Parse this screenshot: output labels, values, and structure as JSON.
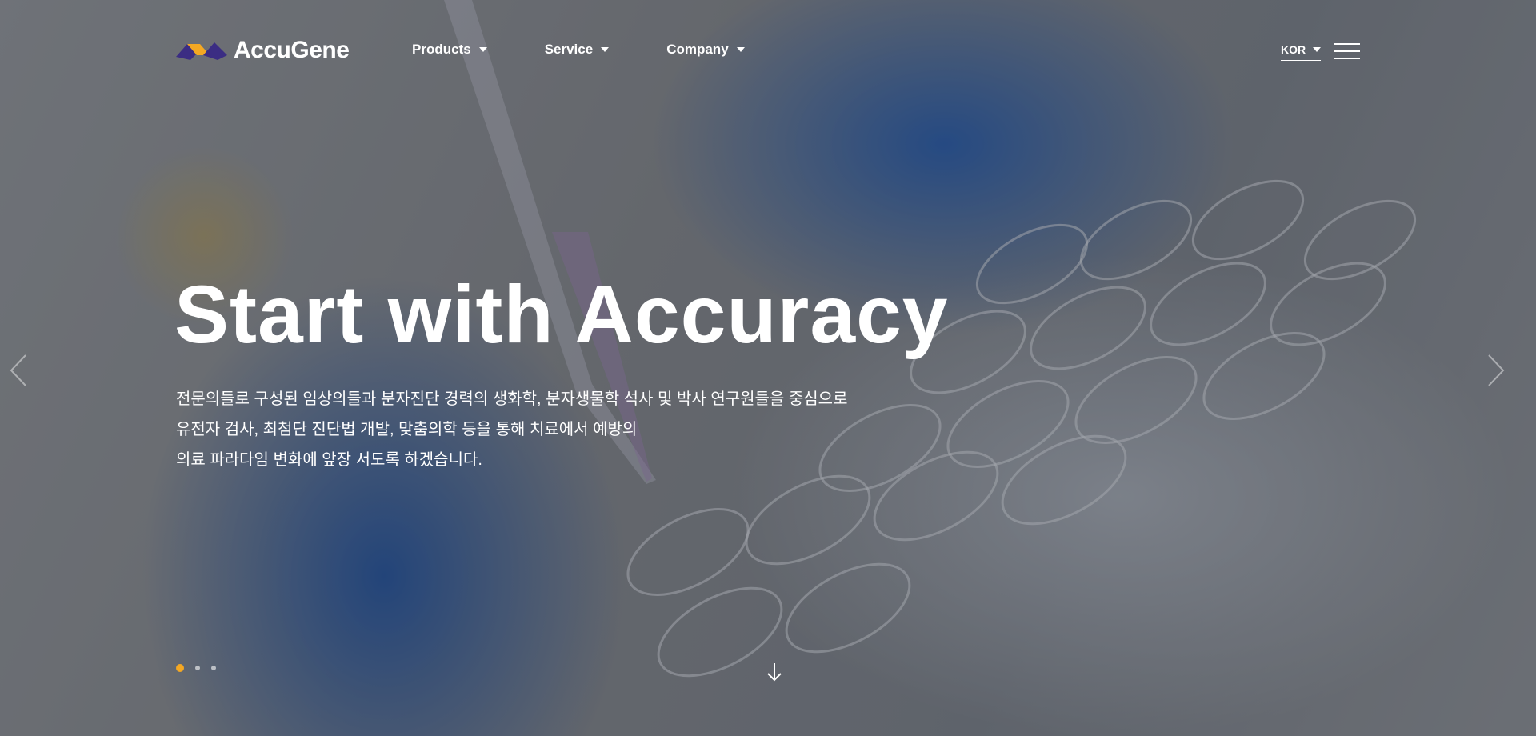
{
  "brand": {
    "name": "AccuGene",
    "accent": "#f4a823",
    "mark_dark": "#3b2d83"
  },
  "nav": {
    "items": [
      {
        "label": "Products"
      },
      {
        "label": "Service"
      },
      {
        "label": "Company"
      }
    ]
  },
  "language": {
    "selected": "KOR"
  },
  "hero": {
    "headline": "Start with Accuracy",
    "description": [
      "전문의들로 구성된 임상의들과 분자진단 경력의 생화학, 분자생물학 석사 및 박사 연구원들을 중심으로",
      "유전자 검사, 최첨단 진단법 개발, 맞춤의학 등을 통해 치료에서 예방의",
      "의료 파라다임 변화에 앞장 서도록 하겠습니다."
    ]
  },
  "slider": {
    "count": 3,
    "active": 1
  },
  "icons": {
    "menu": "hamburger-icon",
    "prev": "chevron-left-icon",
    "next": "chevron-right-icon",
    "scroll": "arrow-down-icon"
  }
}
